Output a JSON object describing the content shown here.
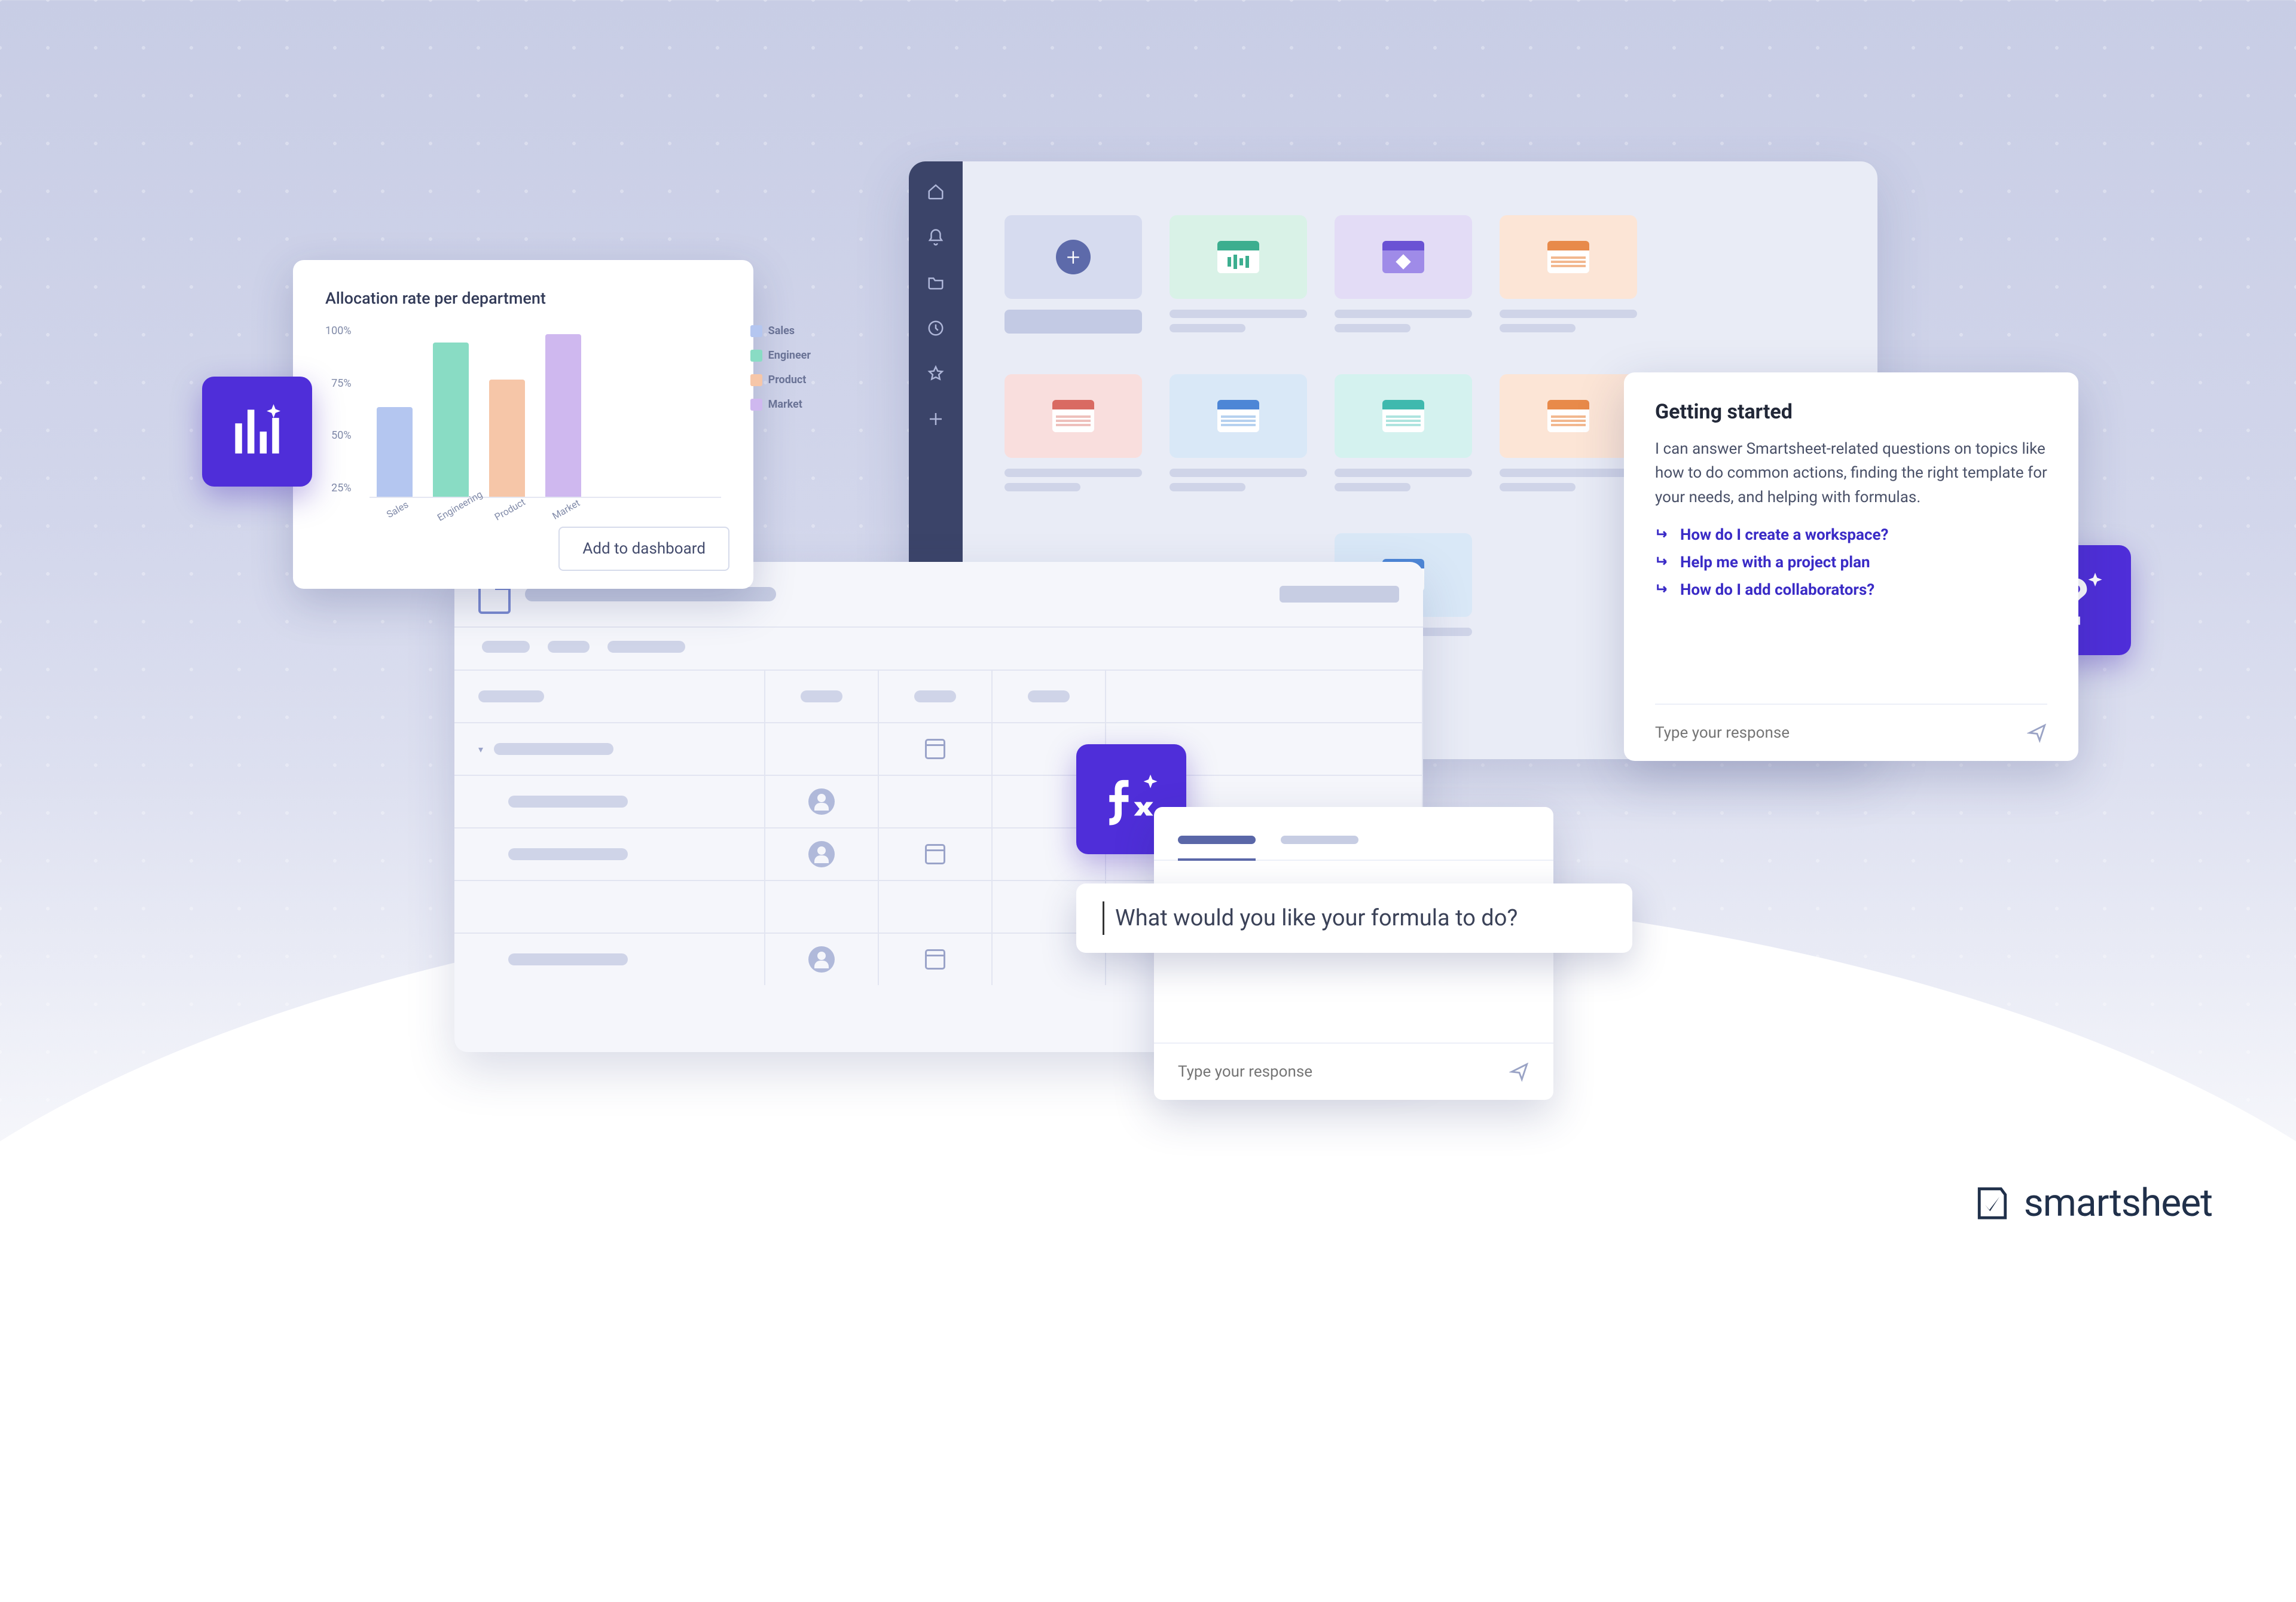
{
  "brand": {
    "name": "smartsheet"
  },
  "chart_data": {
    "type": "bar",
    "title": "Allocation rate per department",
    "categories": [
      "Sales",
      "Engineering",
      "Product",
      "Market"
    ],
    "values": [
      55,
      95,
      72,
      100
    ],
    "ylabel": "",
    "ylim": [
      0,
      100
    ],
    "yticks": [
      "100%",
      "75%",
      "50%",
      "25%"
    ],
    "series": [
      {
        "name": "Sales",
        "color": "#b4c6f0"
      },
      {
        "name": "Engineer",
        "color": "#89dcc4"
      },
      {
        "name": "Product",
        "color": "#f6c6a8"
      },
      {
        "name": "Market",
        "color": "#cfb8ef"
      }
    ],
    "action_label": "Add to dashboard"
  },
  "getting_started": {
    "title": "Getting started",
    "body": "I can answer Smartsheet-related questions on topics like how to do common actions, finding the right template for your needs, and helping with formulas.",
    "suggestions": [
      "How do I create a workspace?",
      "Help me with a project plan",
      "How do I add collaborators?"
    ],
    "input_placeholder": "Type your response"
  },
  "formula": {
    "prompt": "What would you like your formula to do?",
    "input_placeholder": "Type your response"
  }
}
